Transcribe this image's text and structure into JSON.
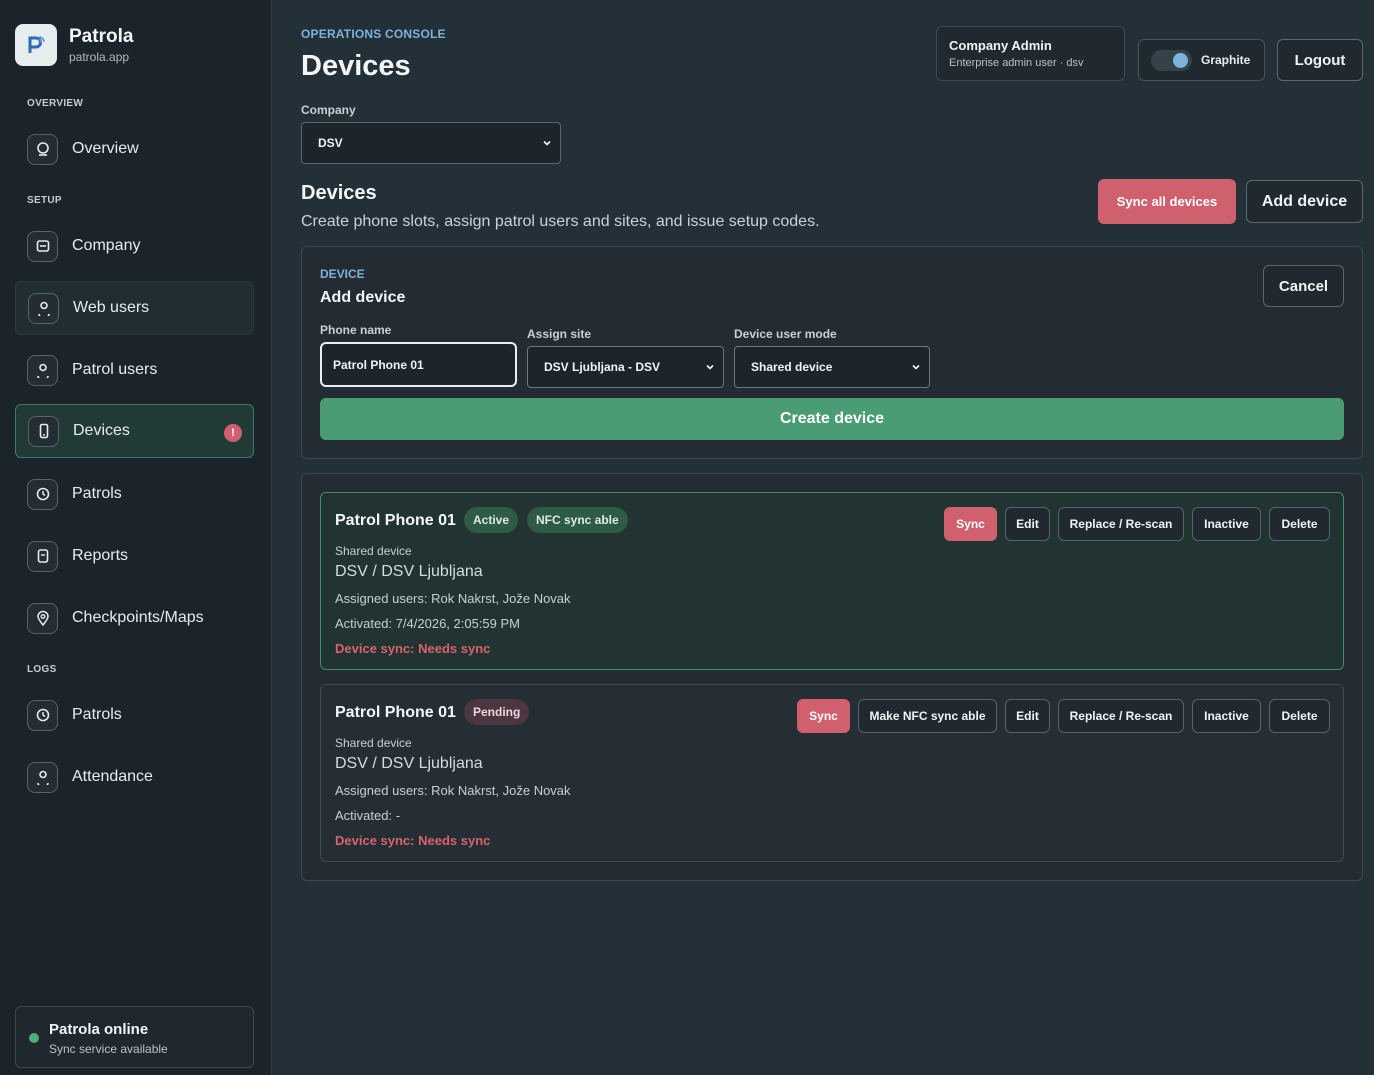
{
  "brand": {
    "name": "Patrola",
    "domain": "patrola.app"
  },
  "sidebar": {
    "sections": {
      "overview": "OVERVIEW",
      "setup": "SETUP",
      "logs": "LOGS"
    },
    "items": [
      {
        "label": "Overview",
        "icon": "overview-icon"
      },
      {
        "label": "Company",
        "icon": "company-icon"
      },
      {
        "label": "Web users",
        "icon": "user-icon"
      },
      {
        "label": "Patrol users",
        "icon": "user-icon"
      },
      {
        "label": "Devices",
        "icon": "phone-icon",
        "badge": "!"
      },
      {
        "label": "Patrols",
        "icon": "clock-icon"
      },
      {
        "label": "Reports",
        "icon": "report-icon"
      },
      {
        "label": "Checkpoints/Maps",
        "icon": "map-pin-icon"
      },
      {
        "label": "Patrols",
        "icon": "clock-icon"
      },
      {
        "label": "Attendance",
        "icon": "user-icon"
      }
    ],
    "status": {
      "title": "Patrola online",
      "subtitle": "Sync service available"
    }
  },
  "header": {
    "eyebrow": "OPERATIONS CONSOLE",
    "title": "Devices",
    "admin": {
      "name": "Company Admin",
      "role": "Enterprise admin user · dsv"
    },
    "theme_label": "Graphite",
    "logout_label": "Logout"
  },
  "company": {
    "label": "Company",
    "selected": "DSV"
  },
  "devices_section": {
    "title": "Devices",
    "description": "Create phone slots, assign patrol users and sites, and issue setup codes.",
    "sync_all_label": "Sync all devices",
    "add_device_label": "Add device"
  },
  "form": {
    "eyebrow": "DEVICE",
    "title": "Add device",
    "cancel_label": "Cancel",
    "phone_name_label": "Phone name",
    "phone_name_value": "Patrol Phone 01",
    "site_label": "Assign site",
    "site_value": "DSV Ljubljana - DSV",
    "mode_label": "Device user mode",
    "mode_value": "Shared device",
    "create_label": "Create device"
  },
  "devices": [
    {
      "name": "Patrol Phone 01",
      "status": "Active",
      "tag": "NFC sync able",
      "mode": "Shared device",
      "location": "DSV / DSV Ljubljana",
      "users": "Assigned users: Rok Nakrst, Jože Novak",
      "activated": "Activated: 7/4/2026, 2:05:59 PM",
      "sync": "Device sync: Needs sync",
      "actions": {
        "sync": "Sync",
        "edit": "Edit",
        "replace": "Replace / Re-scan",
        "inactive": "Inactive",
        "delete": "Delete"
      }
    },
    {
      "name": "Patrol Phone 01",
      "status": "Pending",
      "mode": "Shared device",
      "location": "DSV / DSV Ljubljana",
      "users": "Assigned users: Rok Nakrst, Jože Novak",
      "activated": "Activated: -",
      "sync": "Device sync: Needs sync",
      "actions": {
        "sync": "Sync",
        "nfc": "Make NFC sync able",
        "edit": "Edit",
        "replace": "Replace / Re-scan",
        "inactive": "Inactive",
        "delete": "Delete"
      }
    }
  ],
  "colors": {
    "accent_blue": "#7fb2db",
    "danger": "#d0606e",
    "success": "#4a9c74",
    "online": "#4caf7a"
  }
}
